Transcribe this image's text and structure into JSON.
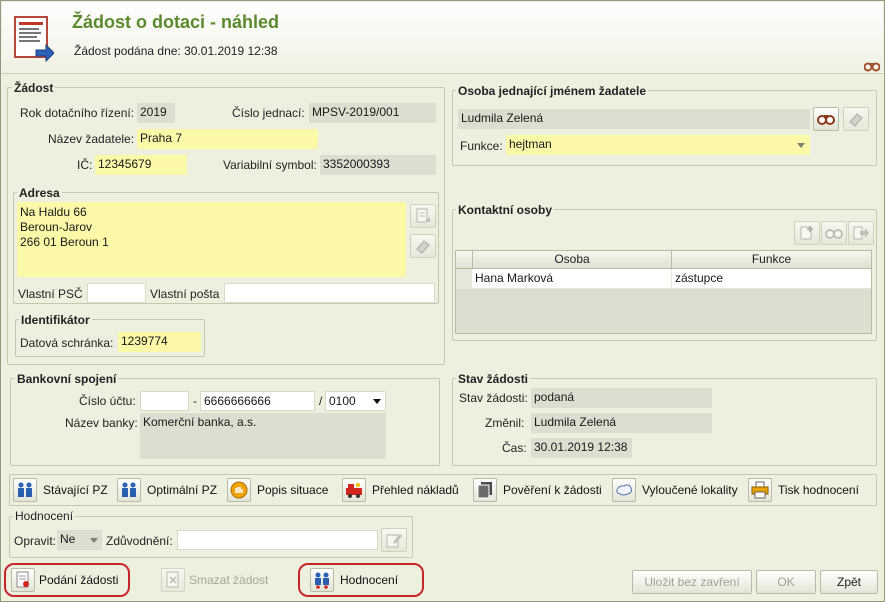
{
  "header": {
    "title": "Žádost o dotaci - náhled",
    "subtitle": "Žádost podána dne: 30.01.2019 12:38"
  },
  "zadost": {
    "legend": "Žádost",
    "rok_label": "Rok dotačního řízení:",
    "rok_value": "2019",
    "cislo_label": "Číslo jednací:",
    "cislo_value": "MPSV-2019/001",
    "nazev_label": "Název žadatele:",
    "nazev_value": "Praha 7",
    "ic_label": "IČ:",
    "ic_value": "12345679",
    "vs_label": "Variabilní symbol:",
    "vs_value": "3352000393"
  },
  "adresa": {
    "legend": "Adresa",
    "text": "Na Haldu 66\nBeroun-Jarov\n266 01 Beroun 1",
    "psc_label": "Vlastní PSČ",
    "psc_value": "",
    "posta_label": "Vlastní pošta",
    "posta_value": ""
  },
  "identifikator": {
    "legend": "Identifikátor",
    "ds_label": "Datová schránka:",
    "ds_value": "1239774"
  },
  "osoba": {
    "legend": "Osoba jednající jménem žadatele",
    "name": "Ludmila Zelená",
    "funkce_label": "Funkce:",
    "funkce_value": "hejtman"
  },
  "kontakty": {
    "legend": "Kontaktní osoby",
    "columns": [
      "Osoba",
      "Funkce"
    ],
    "rows": [
      {
        "osoba": "Hana Marková",
        "funkce": "zástupce"
      }
    ]
  },
  "banka": {
    "legend": "Bankovní spojení",
    "ucet_label": "Číslo účtu:",
    "prefix": "",
    "dash": "-",
    "ucet_value": "6666666666",
    "slash": "/",
    "kod_value": "0100",
    "nazev_label": "Název banky:",
    "nazev_value": "Komerční banka, a.s."
  },
  "stav": {
    "legend": "Stav žádosti",
    "stav_label": "Stav žádosti:",
    "stav_value": "podaná",
    "zmenil_label": "Změnil:",
    "zmenil_value": "Ludmila Zelená",
    "cas_label": "Čas:",
    "cas_value": "30.01.2019 12:38"
  },
  "toolbar": {
    "items": [
      {
        "label": "Stávající PZ"
      },
      {
        "label": "Optimální PZ"
      },
      {
        "label": "Popis situace"
      },
      {
        "label": "Přehled nákladů"
      },
      {
        "label": "Pověření k žádosti"
      },
      {
        "label": "Vyloučené lokality"
      },
      {
        "label": "Tisk hodnocení"
      }
    ]
  },
  "hodnoceni": {
    "legend": "Hodnocení",
    "opravit_label": "Opravit:",
    "opravit_value": "Ne",
    "zduvodneni_label": "Zdůvodnění:",
    "zduvodneni_value": ""
  },
  "footer": {
    "podani": "Podání žádosti",
    "smazat": "Smazat žádost",
    "hodnoceni": "Hodnocení",
    "ulozit": "Uložit bez zavření",
    "ok": "OK",
    "zpet": "Zpět"
  },
  "colors": {
    "title": "#5b8a2e",
    "required": "#fbf8a8",
    "readonly": "#dcdfd0",
    "highlight_ring": "#c8252b"
  }
}
